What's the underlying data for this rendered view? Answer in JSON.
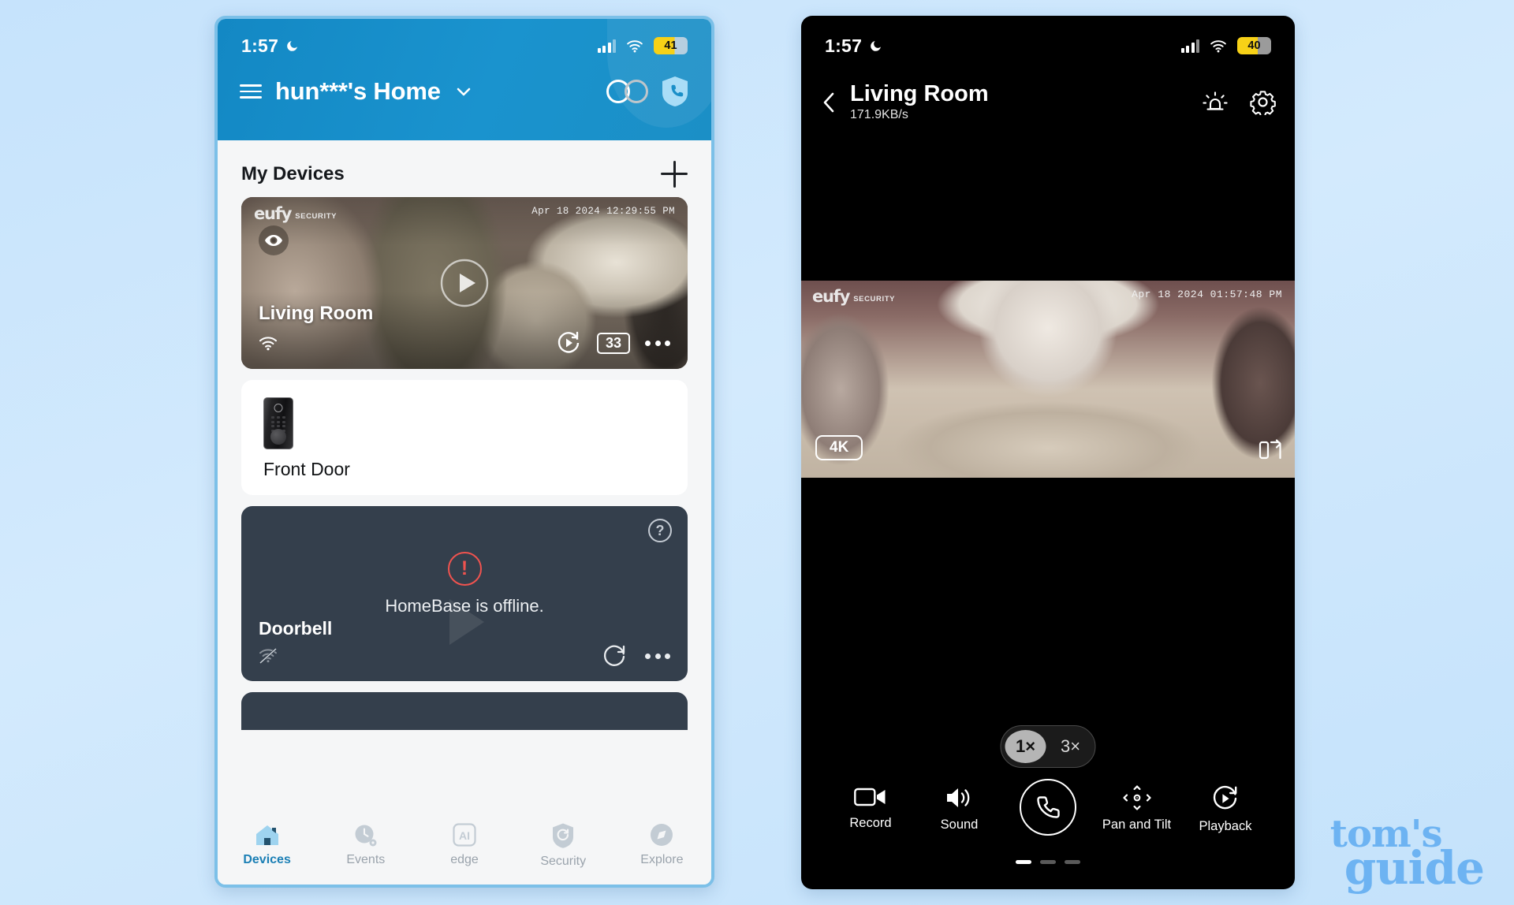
{
  "watermark": {
    "line1": "tom's",
    "line2": "guide"
  },
  "left_phone": {
    "status_bar": {
      "time": "1:57",
      "battery_percent": "41",
      "moon_icon": "moon-icon",
      "signal_icon": "cellular-signal-icon",
      "wifi_icon": "wifi-icon"
    },
    "header": {
      "home_name": "hun***'s Home",
      "menu_icon": "hamburger-menu-icon",
      "chevron_icon": "chevron-down-icon",
      "mode_toggle_icon": "security-mode-toggle-icon",
      "shield_icon": "shield-phone-icon",
      "accent_color": "#1a8fc8"
    },
    "section": {
      "title": "My Devices",
      "add_label": "+",
      "add_icon": "plus-icon"
    },
    "devices": [
      {
        "name": "Living Room",
        "type": "camera",
        "brand_logo": "eufy",
        "brand_sub": "SECURITY",
        "timestamp": "Apr 18 2024  12:29:55 PM",
        "badge": "33",
        "eye_icon": "eye-icon",
        "wifi_icon": "wifi-icon",
        "play_icon": "play-icon",
        "replay_icon": "replay-icon",
        "more_icon": "more-options-icon"
      },
      {
        "name": "Front Door",
        "type": "lock",
        "device_icon": "smart-lock-icon"
      },
      {
        "name": "Doorbell",
        "type": "doorbell",
        "status_message": "HomeBase is offline.",
        "warning_icon": "warning-icon",
        "help_icon": "help-question-icon",
        "wifi_off_icon": "wifi-off-icon",
        "refresh_icon": "refresh-icon",
        "more_icon": "more-options-icon"
      }
    ],
    "bottom_nav": [
      {
        "label": "Devices",
        "icon": "home-icon",
        "active": true
      },
      {
        "label": "Events",
        "icon": "clock-icon",
        "active": false
      },
      {
        "label": "edge",
        "icon": "ai-icon",
        "active": false
      },
      {
        "label": "Security",
        "icon": "shield-icon",
        "active": false
      },
      {
        "label": "Explore",
        "icon": "compass-icon",
        "active": false
      }
    ]
  },
  "right_phone": {
    "status_bar": {
      "time": "1:57",
      "battery_percent": "40",
      "moon_icon": "moon-icon",
      "signal_icon": "cellular-signal-icon",
      "wifi_icon": "wifi-icon"
    },
    "header": {
      "title": "Living Room",
      "bitrate": "171.9KB/s",
      "back_icon": "back-chevron-icon",
      "siren_icon": "siren-alarm-icon",
      "settings_icon": "gear-icon"
    },
    "video": {
      "brand_logo": "eufy",
      "brand_sub": "SECURITY",
      "timestamp": "Apr 18 2024  01:57:48 PM",
      "quality_badge": "4K",
      "pip_icon": "picture-in-picture-icon"
    },
    "zoom_levels": [
      {
        "label": "1×",
        "selected": true
      },
      {
        "label": "3×",
        "selected": false
      }
    ],
    "controls": [
      {
        "label": "Record",
        "icon": "video-camera-icon"
      },
      {
        "label": "Sound",
        "icon": "speaker-icon"
      },
      {
        "label": "",
        "icon": "phone-talk-icon"
      },
      {
        "label": "Pan and Tilt",
        "icon": "pan-tilt-icon"
      },
      {
        "label": "Playback",
        "icon": "playback-icon"
      }
    ],
    "page_dots": {
      "total": 3,
      "active_index": 0
    }
  }
}
